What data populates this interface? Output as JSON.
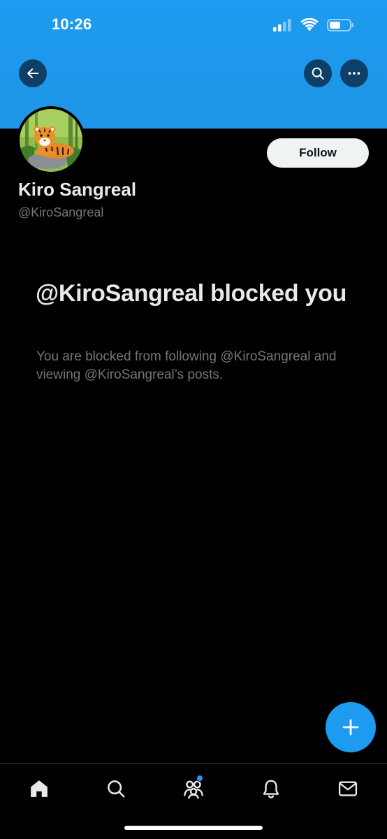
{
  "status_bar": {
    "time": "10:26"
  },
  "header": {
    "banner_color": "#1d9bf0",
    "back_icon": "arrow-left-icon",
    "search_icon": "search-icon",
    "more_icon": "more-horizontal-icon"
  },
  "profile": {
    "display_name": "Kiro Sangreal",
    "handle": "@KiroSangreal",
    "follow_label": "Follow",
    "avatar_icon": "tiger-avatar"
  },
  "blocked_notice": {
    "title": "@KiroSangreal blocked you",
    "description": "You are blocked from following @KiroSangreal and viewing @KiroSangreal’s posts."
  },
  "fab": {
    "icon": "plus-icon",
    "color": "#1d9bf0"
  },
  "tab_bar": {
    "items": [
      {
        "name": "home",
        "icon": "home-icon"
      },
      {
        "name": "search",
        "icon": "search-icon"
      },
      {
        "name": "communities",
        "icon": "communities-icon"
      },
      {
        "name": "notifications",
        "icon": "bell-icon"
      },
      {
        "name": "messages",
        "icon": "mail-icon"
      }
    ]
  }
}
